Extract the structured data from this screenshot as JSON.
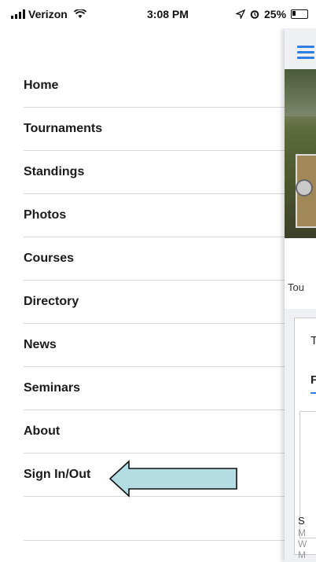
{
  "status_bar": {
    "carrier": "Verizon",
    "time": "3:08 PM",
    "battery": "25%"
  },
  "menu": {
    "items": [
      {
        "label": "Home"
      },
      {
        "label": "Tournaments"
      },
      {
        "label": "Standings"
      },
      {
        "label": "Photos"
      },
      {
        "label": "Courses"
      },
      {
        "label": "Directory"
      },
      {
        "label": "News"
      },
      {
        "label": "Seminars"
      },
      {
        "label": "About"
      },
      {
        "label": "Sign In/Out"
      }
    ]
  },
  "background_app": {
    "partial_text_tou": "Tou",
    "partial_tab_t": "T",
    "partial_tab_f": "F",
    "partial_s": "S",
    "partial_m1": "M",
    "partial_w": "W",
    "partial_m2": "M",
    "accent_color": "#2f7de1"
  },
  "annotation": {
    "arrow_color": "#b3dde3",
    "arrow_target": "Sign In/Out"
  }
}
